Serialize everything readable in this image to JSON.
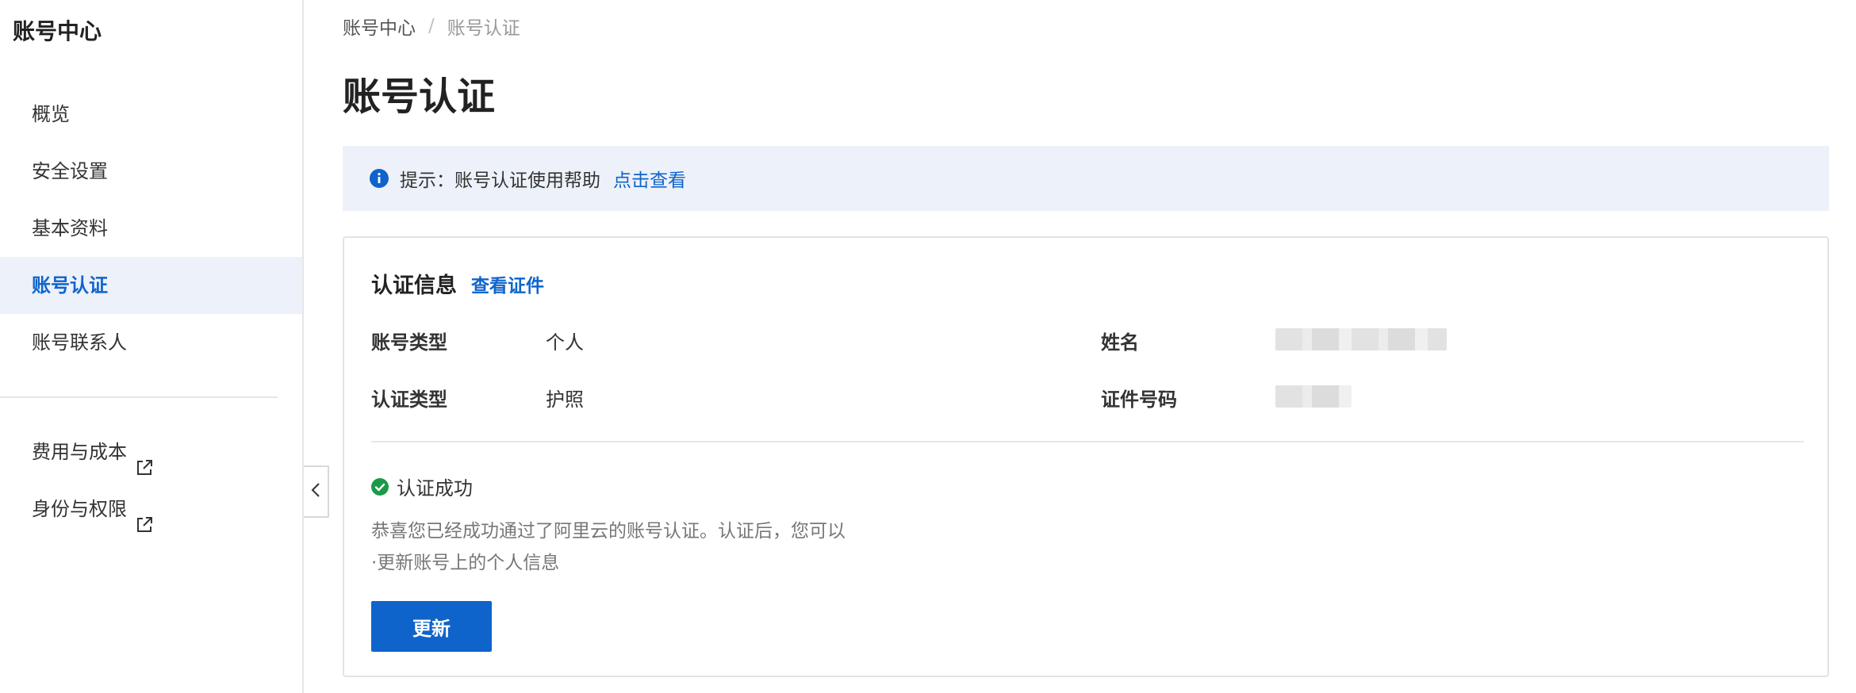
{
  "sidebar": {
    "title": "账号中心",
    "items": [
      {
        "label": "概览"
      },
      {
        "label": "安全设置"
      },
      {
        "label": "基本资料"
      },
      {
        "label": "账号认证"
      },
      {
        "label": "账号联系人"
      }
    ],
    "external_items": [
      {
        "label": "费用与成本",
        "icon": "external-link-icon"
      },
      {
        "label": "身份与权限",
        "icon": "external-link-icon"
      }
    ]
  },
  "breadcrumb": {
    "root": "账号中心",
    "separator": "/",
    "current": "账号认证"
  },
  "page": {
    "title": "账号认证"
  },
  "notice": {
    "text": "提示：账号认证使用帮助",
    "link": "点击查看"
  },
  "card": {
    "title": "认证信息",
    "link": "查看证件",
    "fields": {
      "account_type_label": "账号类型",
      "account_type_value": "个人",
      "cert_type_label": "认证类型",
      "cert_type_value": "护照",
      "name_label": "姓名",
      "id_number_label": "证件号码"
    },
    "status": "认证成功",
    "desc_line1": "恭喜您已经成功通过了阿里云的账号认证。认证后，您可以",
    "desc_line2": "·更新账号上的个人信息",
    "button": "更新"
  },
  "colors": {
    "accent": "#0f64cc",
    "success": "#1a9a48",
    "active_bg": "#edf1f9"
  }
}
